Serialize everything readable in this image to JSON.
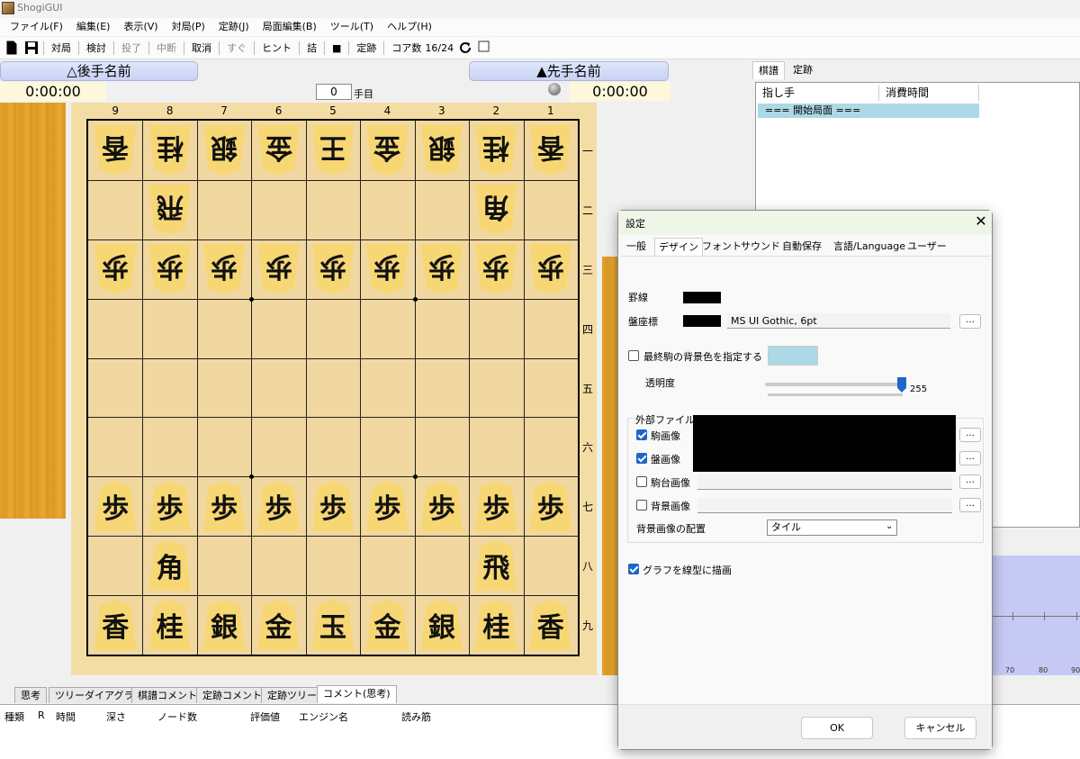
{
  "app": {
    "title": "ShogiGUI"
  },
  "menu": [
    "ファイル(F)",
    "編集(E)",
    "表示(V)",
    "対局(P)",
    "定跡(J)",
    "局面編集(B)",
    "ツール(T)",
    "ヘルプ(H)"
  ],
  "toolbar": {
    "play": "対局",
    "study": "検討",
    "resign": "投了",
    "interrupt": "中断",
    "cancel": "取消",
    "now": "すぐ",
    "hint": "ヒント",
    "mate": "詰",
    "stop": "■",
    "joseki": "定跡",
    "cores_label": "コア数",
    "cores_value": "16/24"
  },
  "players": {
    "gote_name": "△後手名前",
    "sente_name": "▲先手名前",
    "gote_clock": "0:00:00",
    "sente_clock": "0:00:00"
  },
  "move": {
    "number": "0",
    "unit": "手目"
  },
  "board": {
    "files": [
      "9",
      "8",
      "7",
      "6",
      "5",
      "4",
      "3",
      "2",
      "1"
    ],
    "ranks": [
      "一",
      "二",
      "三",
      "四",
      "五",
      "六",
      "七",
      "八",
      "九"
    ],
    "pieces": [
      {
        "r": 0,
        "f": 0,
        "ch": "香",
        "side": "gote"
      },
      {
        "r": 0,
        "f": 1,
        "ch": "桂",
        "side": "gote"
      },
      {
        "r": 0,
        "f": 2,
        "ch": "銀",
        "side": "gote"
      },
      {
        "r": 0,
        "f": 3,
        "ch": "金",
        "side": "gote"
      },
      {
        "r": 0,
        "f": 4,
        "ch": "王",
        "side": "gote"
      },
      {
        "r": 0,
        "f": 5,
        "ch": "金",
        "side": "gote"
      },
      {
        "r": 0,
        "f": 6,
        "ch": "銀",
        "side": "gote"
      },
      {
        "r": 0,
        "f": 7,
        "ch": "桂",
        "side": "gote"
      },
      {
        "r": 0,
        "f": 8,
        "ch": "香",
        "side": "gote"
      },
      {
        "r": 1,
        "f": 1,
        "ch": "飛",
        "side": "gote"
      },
      {
        "r": 1,
        "f": 7,
        "ch": "角",
        "side": "gote"
      },
      {
        "r": 2,
        "f": 0,
        "ch": "歩",
        "side": "gote"
      },
      {
        "r": 2,
        "f": 1,
        "ch": "歩",
        "side": "gote"
      },
      {
        "r": 2,
        "f": 2,
        "ch": "歩",
        "side": "gote"
      },
      {
        "r": 2,
        "f": 3,
        "ch": "歩",
        "side": "gote"
      },
      {
        "r": 2,
        "f": 4,
        "ch": "歩",
        "side": "gote"
      },
      {
        "r": 2,
        "f": 5,
        "ch": "歩",
        "side": "gote"
      },
      {
        "r": 2,
        "f": 6,
        "ch": "歩",
        "side": "gote"
      },
      {
        "r": 2,
        "f": 7,
        "ch": "歩",
        "side": "gote"
      },
      {
        "r": 2,
        "f": 8,
        "ch": "歩",
        "side": "gote"
      },
      {
        "r": 6,
        "f": 0,
        "ch": "歩",
        "side": "sente"
      },
      {
        "r": 6,
        "f": 1,
        "ch": "歩",
        "side": "sente"
      },
      {
        "r": 6,
        "f": 2,
        "ch": "歩",
        "side": "sente"
      },
      {
        "r": 6,
        "f": 3,
        "ch": "歩",
        "side": "sente"
      },
      {
        "r": 6,
        "f": 4,
        "ch": "歩",
        "side": "sente"
      },
      {
        "r": 6,
        "f": 5,
        "ch": "歩",
        "side": "sente"
      },
      {
        "r": 6,
        "f": 6,
        "ch": "歩",
        "side": "sente"
      },
      {
        "r": 6,
        "f": 7,
        "ch": "歩",
        "side": "sente"
      },
      {
        "r": 6,
        "f": 8,
        "ch": "歩",
        "side": "sente"
      },
      {
        "r": 7,
        "f": 1,
        "ch": "角",
        "side": "sente"
      },
      {
        "r": 7,
        "f": 7,
        "ch": "飛",
        "side": "sente"
      },
      {
        "r": 8,
        "f": 0,
        "ch": "香",
        "side": "sente"
      },
      {
        "r": 8,
        "f": 1,
        "ch": "桂",
        "side": "sente"
      },
      {
        "r": 8,
        "f": 2,
        "ch": "銀",
        "side": "sente"
      },
      {
        "r": 8,
        "f": 3,
        "ch": "金",
        "side": "sente"
      },
      {
        "r": 8,
        "f": 4,
        "ch": "玉",
        "side": "sente"
      },
      {
        "r": 8,
        "f": 5,
        "ch": "金",
        "side": "sente"
      },
      {
        "r": 8,
        "f": 6,
        "ch": "銀",
        "side": "sente"
      },
      {
        "r": 8,
        "f": 7,
        "ch": "桂",
        "side": "sente"
      },
      {
        "r": 8,
        "f": 8,
        "ch": "香",
        "side": "sente"
      }
    ]
  },
  "kifu": {
    "tabs": [
      "棋譜",
      "定跡"
    ],
    "col_move": "指し手",
    "col_time": "消費時間",
    "rows": [
      "=== 開始局面 ==="
    ]
  },
  "graph": {
    "ticks": [
      "70",
      "80",
      "90"
    ]
  },
  "bottom_tabs": [
    "思考",
    "ツリーダイアグラム",
    "棋譜コメント",
    "定跡コメント",
    "定跡ツリー",
    "コメント(思考)"
  ],
  "analysis_cols": [
    "種類",
    "R",
    "時間",
    "深さ",
    "ノード数",
    "評価値",
    "エンジン名",
    "読み筋"
  ],
  "dialog": {
    "title": "設定",
    "close": "✕",
    "tabs": [
      "一般",
      "デザイン",
      "フォント",
      "サウンド",
      "自動保存",
      "言語/Language",
      "ユーザー"
    ],
    "active_tab": "デザイン",
    "grid_line_label": "罫線",
    "coord_label": "盤座標",
    "coord_font": "MS UI Gothic, 6pt",
    "last_move_bg_label": "最終駒の背景色を指定する",
    "last_move_color": "#add8e6",
    "opacity_label": "透明度",
    "opacity_value": "255",
    "ext_files_label": "外部ファイル",
    "piece_image_label": "駒画像",
    "board_image_label": "盤画像",
    "stand_image_label": "駒台画像",
    "bg_image_label": "背景画像",
    "bg_layout_label": "背景画像の配置",
    "bg_layout_value": "タイル",
    "graph_linear_label": "グラフを線型に描画",
    "dots": "...",
    "ok": "OK",
    "cancel": "キャンセル"
  }
}
